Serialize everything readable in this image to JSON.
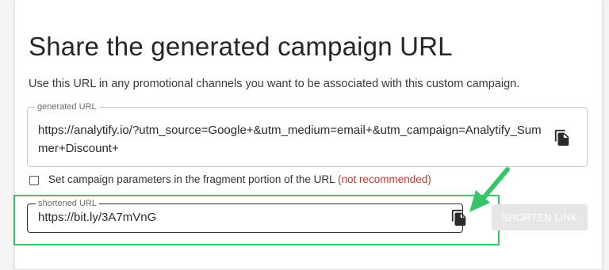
{
  "section": {
    "title": "Share the generated campaign URL",
    "description": "Use this URL in any promotional channels you want to be associated with this custom campaign."
  },
  "generated_url": {
    "legend": "generated URL",
    "value": "https://analytify.io/?utm_source=Google+&utm_medium=email+&utm_campaign=Analytify_Summer+Discount+",
    "copy_icon": "copy-icon"
  },
  "fragment_option": {
    "checked": false,
    "label": "Set campaign parameters in the fragment portion of the URL",
    "warning": "(not recommended)"
  },
  "shortened_url": {
    "legend": "shortened URL",
    "value": "https://bit.ly/3A7mVnG",
    "copy_icon": "copy-icon"
  },
  "shorten_button": {
    "label": "SHORTEN LINK",
    "enabled": false
  },
  "colors": {
    "highlight": "#35c46a",
    "warning": "#c0392b"
  }
}
